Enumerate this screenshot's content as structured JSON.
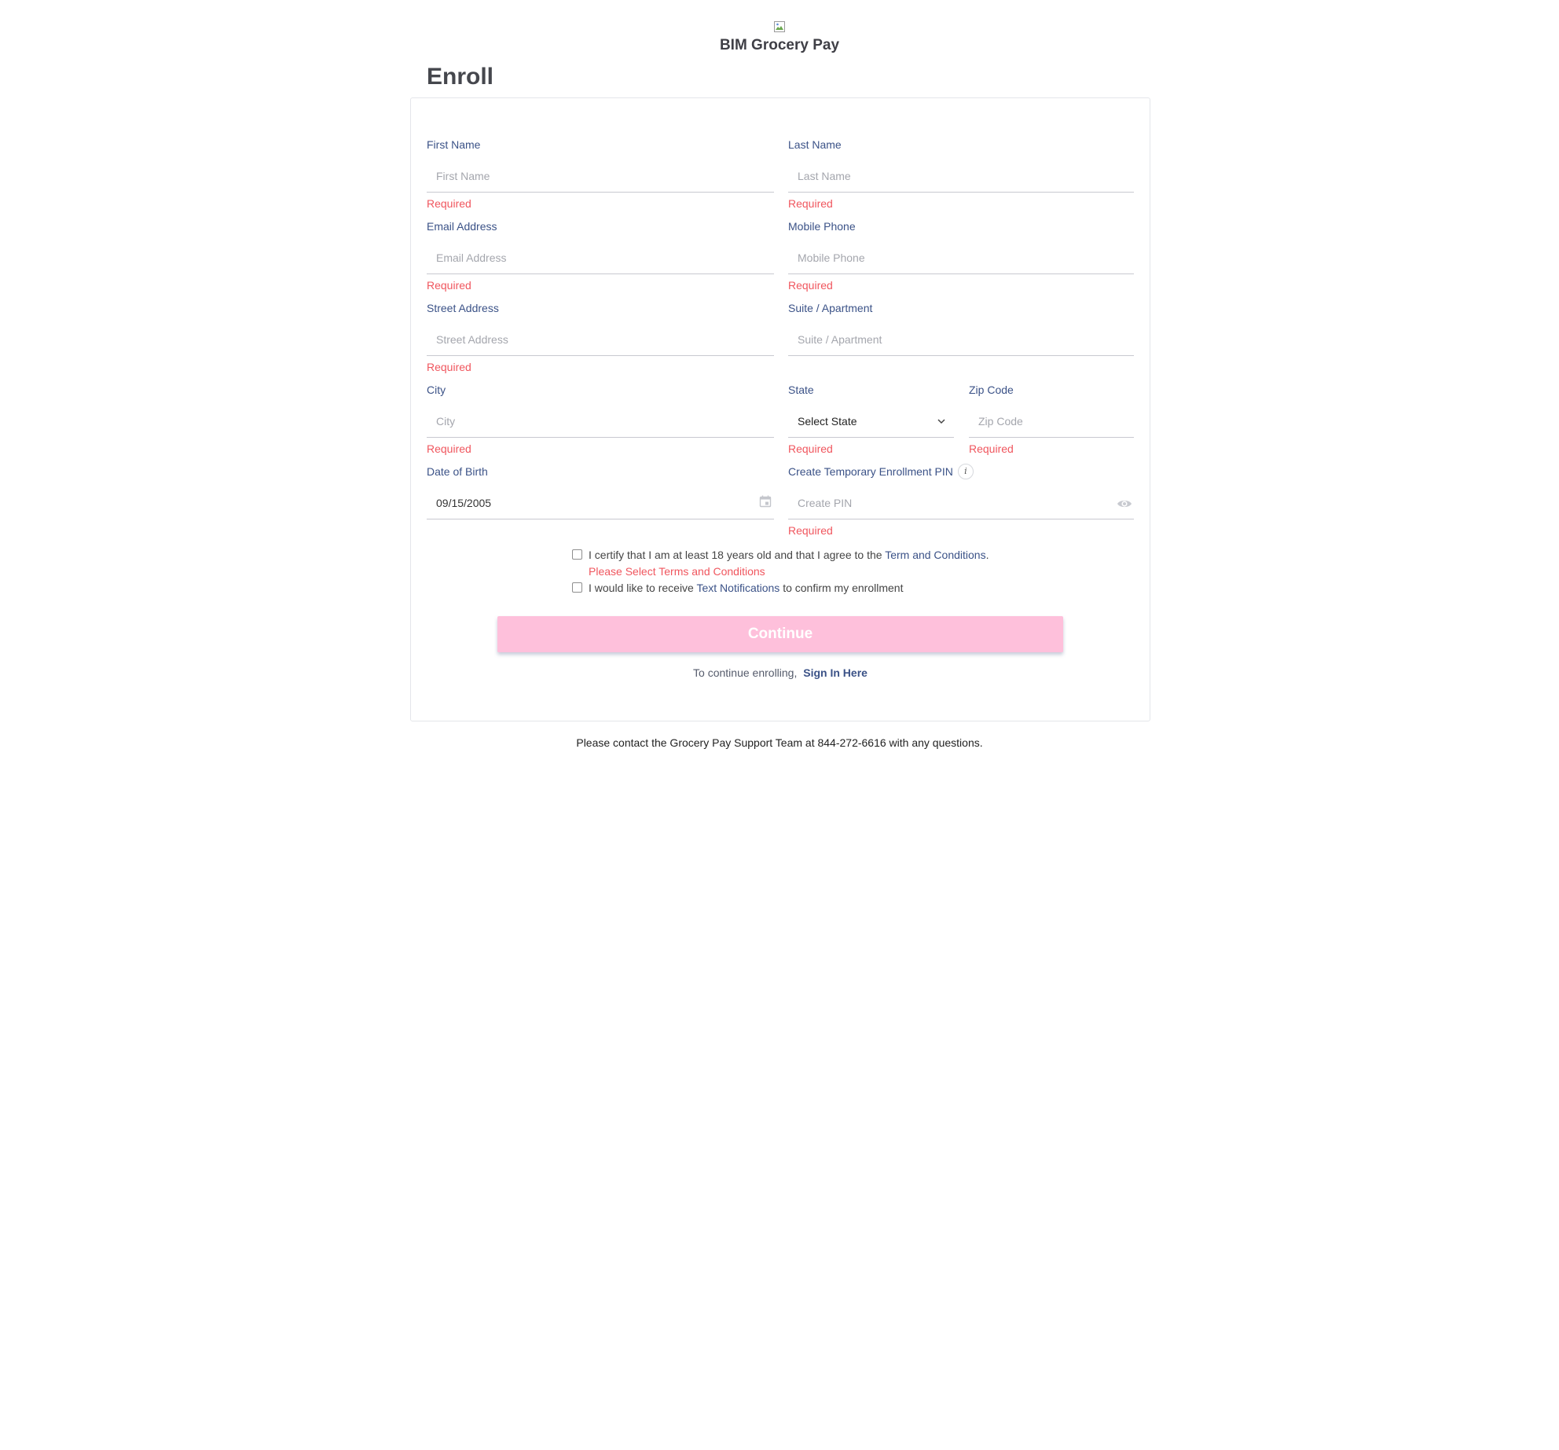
{
  "brand": {
    "logo_alt": "BIM Grocery Pay"
  },
  "page": {
    "title": "Enroll"
  },
  "form": {
    "first_name": {
      "label": "First Name",
      "placeholder": "First Name",
      "error": "Required"
    },
    "last_name": {
      "label": "Last Name",
      "placeholder": "Last Name",
      "error": "Required"
    },
    "email": {
      "label": "Email Address",
      "placeholder": "Email Address",
      "error": "Required"
    },
    "mobile": {
      "label": "Mobile Phone",
      "placeholder": "Mobile Phone",
      "error": "Required"
    },
    "street": {
      "label": "Street Address",
      "placeholder": "Street Address",
      "error": "Required"
    },
    "suite": {
      "label": "Suite / Apartment",
      "placeholder": "Suite / Apartment"
    },
    "city": {
      "label": "City",
      "placeholder": "City",
      "error": "Required"
    },
    "state": {
      "label": "State",
      "selected": "Select State",
      "error": "Required"
    },
    "zip": {
      "label": "Zip Code",
      "placeholder": "Zip Code",
      "error": "Required"
    },
    "dob": {
      "label": "Date of Birth",
      "value": "09/15/2005"
    },
    "pin": {
      "label": "Create Temporary Enrollment PIN",
      "placeholder": "Create PIN",
      "error": "Required",
      "info_glyph": "i"
    }
  },
  "checkboxes": {
    "terms": {
      "text_before": "I certify that I am at least 18 years old and that I agree to the ",
      "link": "Term and Conditions",
      "text_after": ".",
      "error": "Please Select Terms and Conditions",
      "checked": false
    },
    "notifications": {
      "text_before": "I would like to receive ",
      "link": "Text Notifications",
      "text_after": " to confirm my enrollment",
      "checked": false
    }
  },
  "actions": {
    "continue_label": "Continue",
    "signin_prompt": "To continue enrolling,",
    "signin_link": "Sign In Here"
  },
  "footer": {
    "text": "Please contact the Grocery Pay Support Team at 844-272-6616 with any questions."
  },
  "colors": {
    "label": "#3b5287",
    "error": "#f0565e",
    "continue_bg": "#fec0db"
  }
}
